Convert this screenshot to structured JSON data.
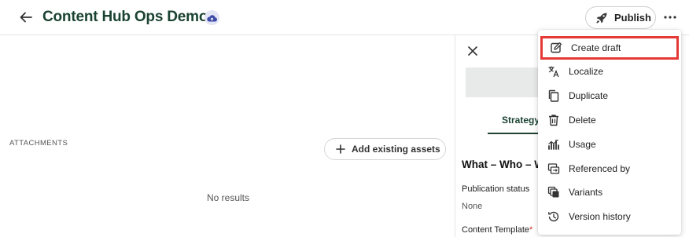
{
  "header": {
    "title": "Content Hub Ops Demo",
    "publish_label": "Publish"
  },
  "main": {
    "attachments_label": "ATTACHMENTS",
    "add_assets_label": "Add existing assets",
    "no_results": "No results"
  },
  "panel": {
    "tab_label": "Strategy",
    "heading": "What – Who – W",
    "publication_status_label": "Publication status",
    "publication_status_value": "None",
    "content_template_label": "Content Template",
    "required_marker": "*"
  },
  "menu": {
    "items": [
      {
        "label": "Create draft",
        "icon": "edit-icon"
      },
      {
        "label": "Localize",
        "icon": "translate-icon"
      },
      {
        "label": "Duplicate",
        "icon": "copy-icon"
      },
      {
        "label": "Delete",
        "icon": "trash-icon"
      },
      {
        "label": "Usage",
        "icon": "usage-icon"
      },
      {
        "label": "Referenced by",
        "icon": "referenced-icon"
      },
      {
        "label": "Variants",
        "icon": "variants-icon"
      },
      {
        "label": "Version history",
        "icon": "history-icon"
      }
    ]
  },
  "colors": {
    "title_green": "#1b4332",
    "highlight_red": "#e53935",
    "badge_bg": "#e3e4f4",
    "badge_icon": "#3d4aa8"
  }
}
